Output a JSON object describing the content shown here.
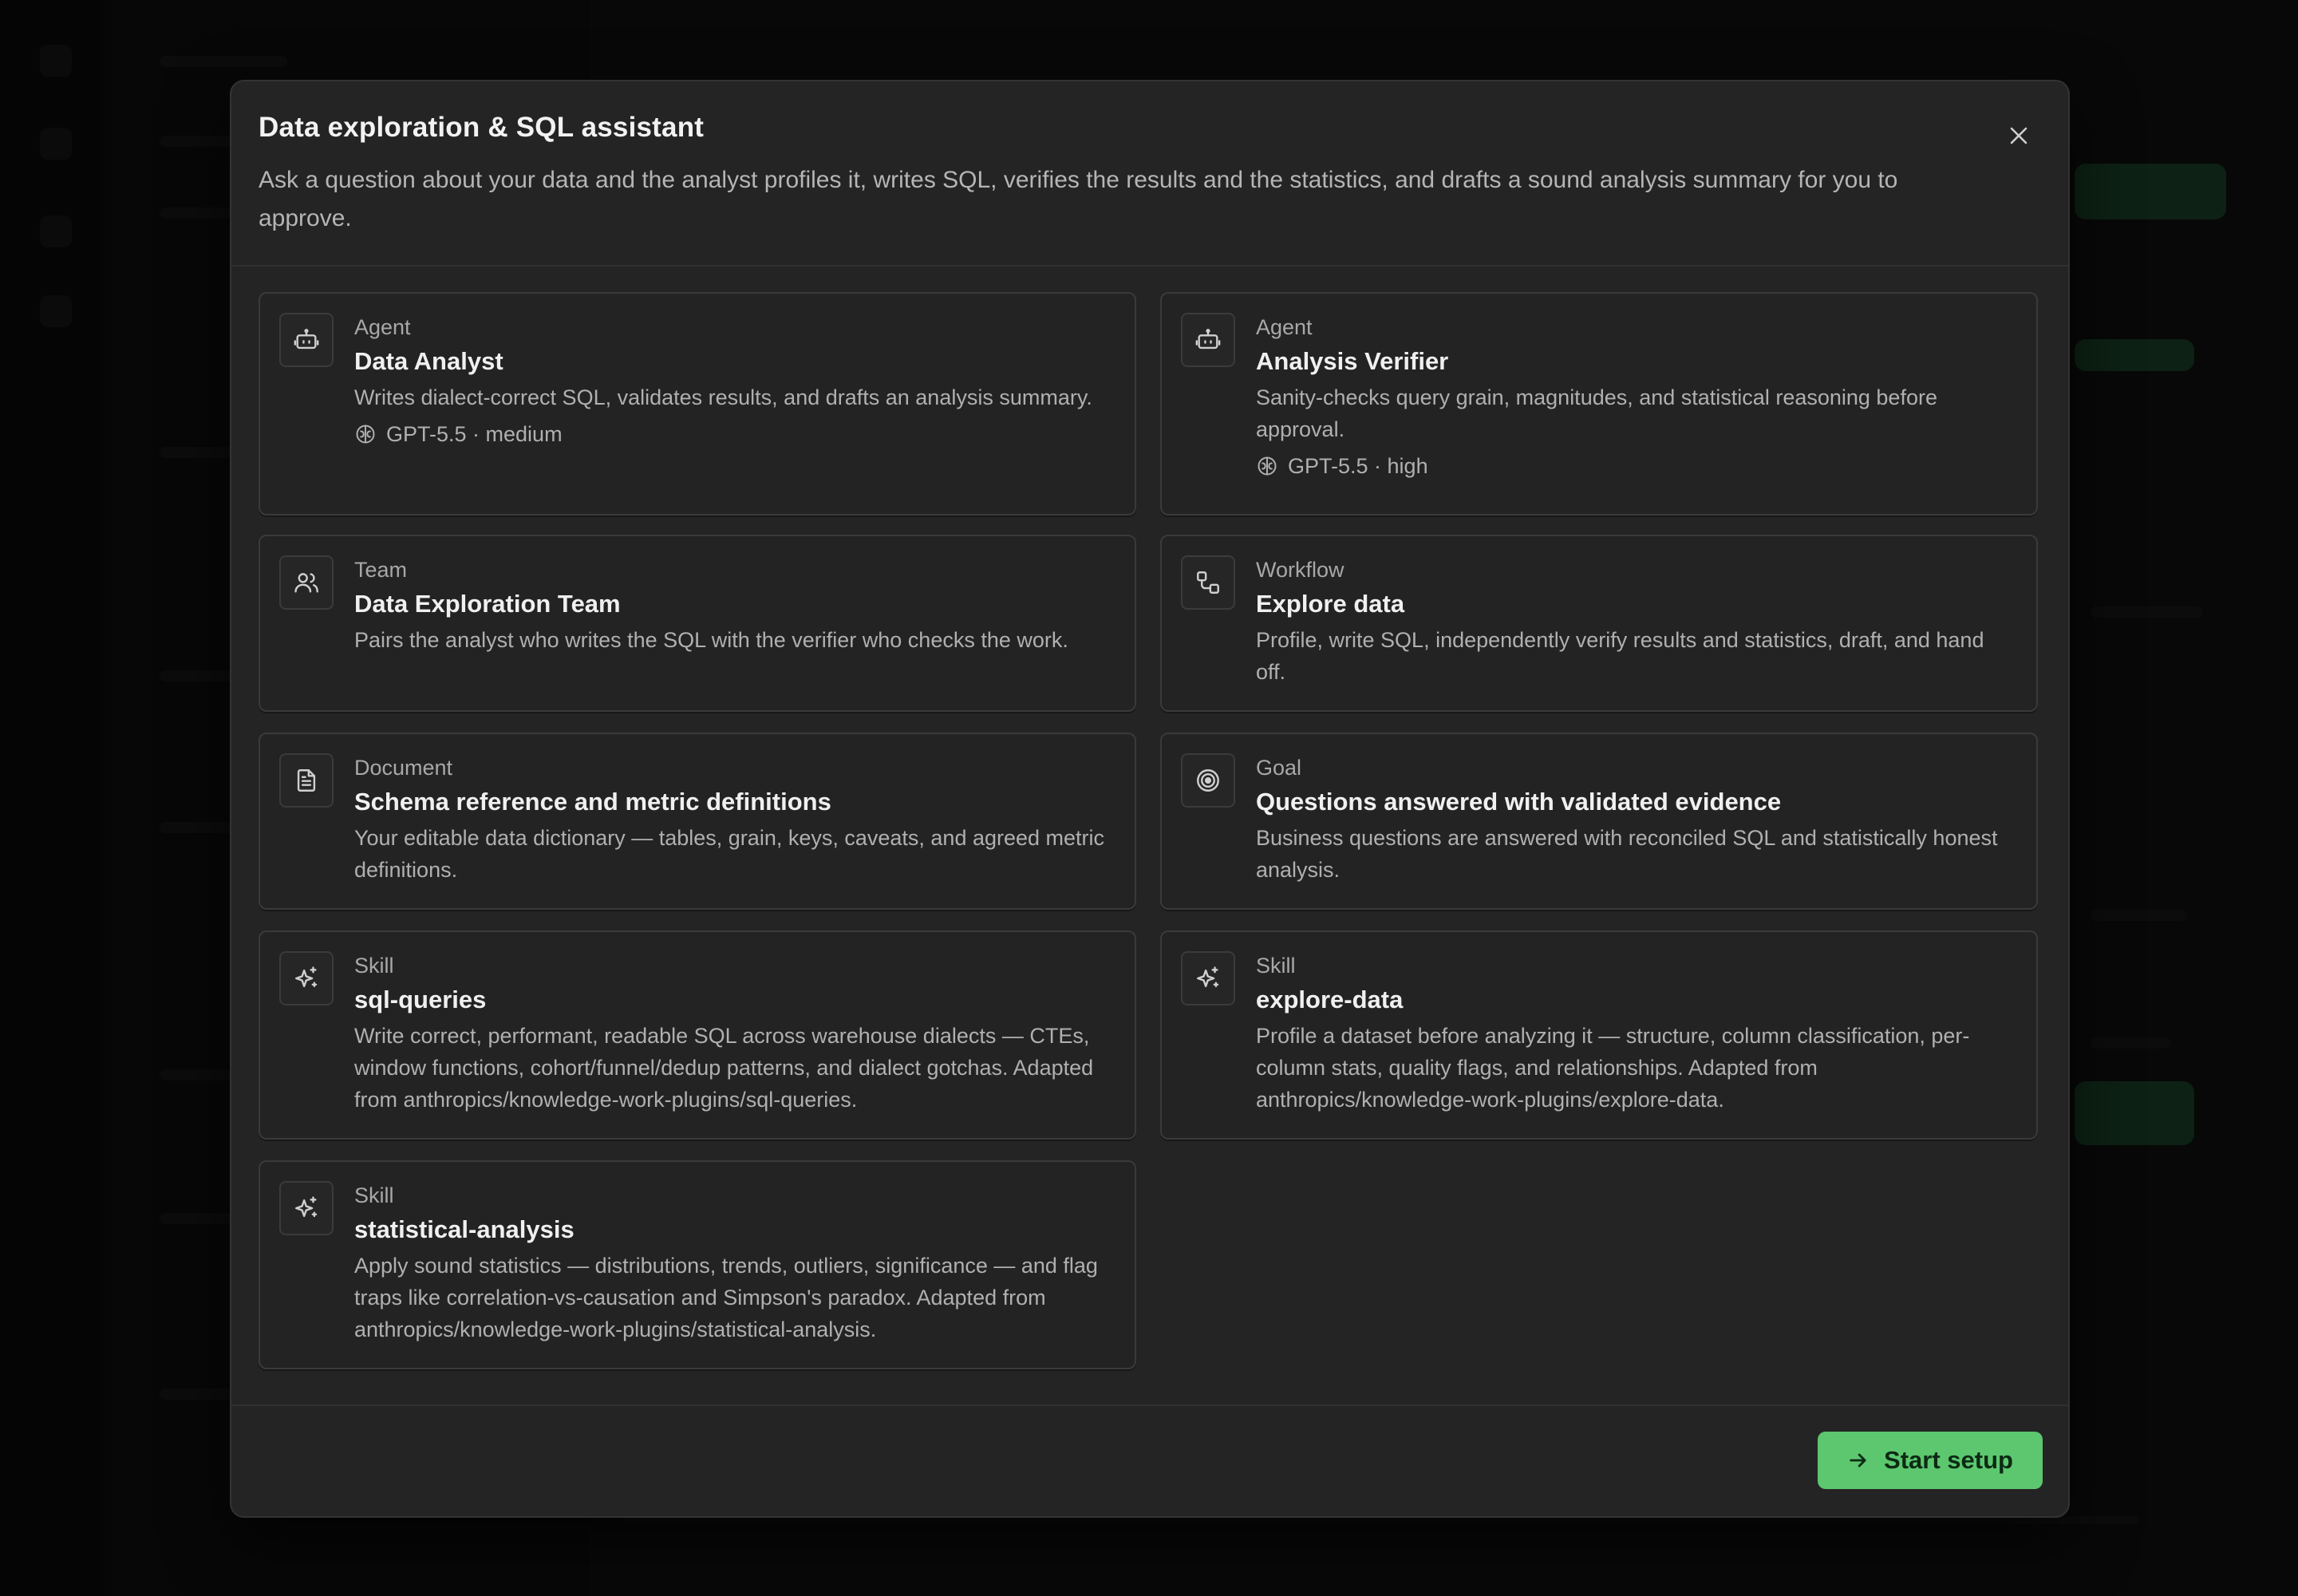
{
  "modal": {
    "title": "Data exploration & SQL assistant",
    "description": "Ask a question about your data and the analyst profiles it, writes SQL, verifies the results and the statistics, and drafts a sound analysis summary for you to approve.",
    "close_icon": "close-icon"
  },
  "cards": [
    {
      "kind": "Agent",
      "name": "Data Analyst",
      "description": "Writes dialect-correct SQL, validates results, and drafts an analysis summary.",
      "model": "GPT-5.5 · medium",
      "icon": "robot-icon",
      "model_icon": "brain-icon"
    },
    {
      "kind": "Agent",
      "name": "Analysis Verifier",
      "description": "Sanity-checks query grain, magnitudes, and statistical reasoning before approval.",
      "model": "GPT-5.5 · high",
      "icon": "robot-icon",
      "model_icon": "brain-icon"
    },
    {
      "kind": "Team",
      "name": "Data Exploration Team",
      "description": "Pairs the analyst who writes the SQL with the verifier who checks the work.",
      "icon": "users-icon"
    },
    {
      "kind": "Workflow",
      "name": "Explore data",
      "description": "Profile, write SQL, independently verify results and statistics, draft, and hand off.",
      "icon": "workflow-icon"
    },
    {
      "kind": "Document",
      "name": "Schema reference and metric definitions",
      "description": "Your editable data dictionary — tables, grain, keys, caveats, and agreed metric definitions.",
      "icon": "document-icon"
    },
    {
      "kind": "Goal",
      "name": "Questions answered with validated evidence",
      "description": "Business questions are answered with reconciled SQL and statistically honest analysis.",
      "icon": "target-icon"
    },
    {
      "kind": "Skill",
      "name": "sql-queries",
      "description": "Write correct, performant, readable SQL across warehouse dialects — CTEs, window functions, cohort/funnel/dedup patterns, and dialect gotchas. Adapted from anthropics/knowledge-work-plugins/sql-queries.",
      "icon": "sparkles-icon"
    },
    {
      "kind": "Skill",
      "name": "explore-data",
      "description": "Profile a dataset before analyzing it — structure, column classification, per-column stats, quality flags, and relationships. Adapted from anthropics/knowledge-work-plugins/explore-data.",
      "icon": "sparkles-icon"
    },
    {
      "kind": "Skill",
      "name": "statistical-analysis",
      "description": "Apply sound statistics — distributions, trends, outliers, significance — and flag traps like correlation-vs-causation and Simpson's paradox. Adapted from anthropics/knowledge-work-plugins/statistical-analysis.",
      "icon": "sparkles-icon"
    }
  ],
  "footer": {
    "start_label": "Start setup",
    "start_icon": "arrow-right-icon"
  },
  "colors": {
    "modal_bg": "#242424",
    "card_border": "#3a3a3a",
    "accent_green": "#5cc76f"
  }
}
